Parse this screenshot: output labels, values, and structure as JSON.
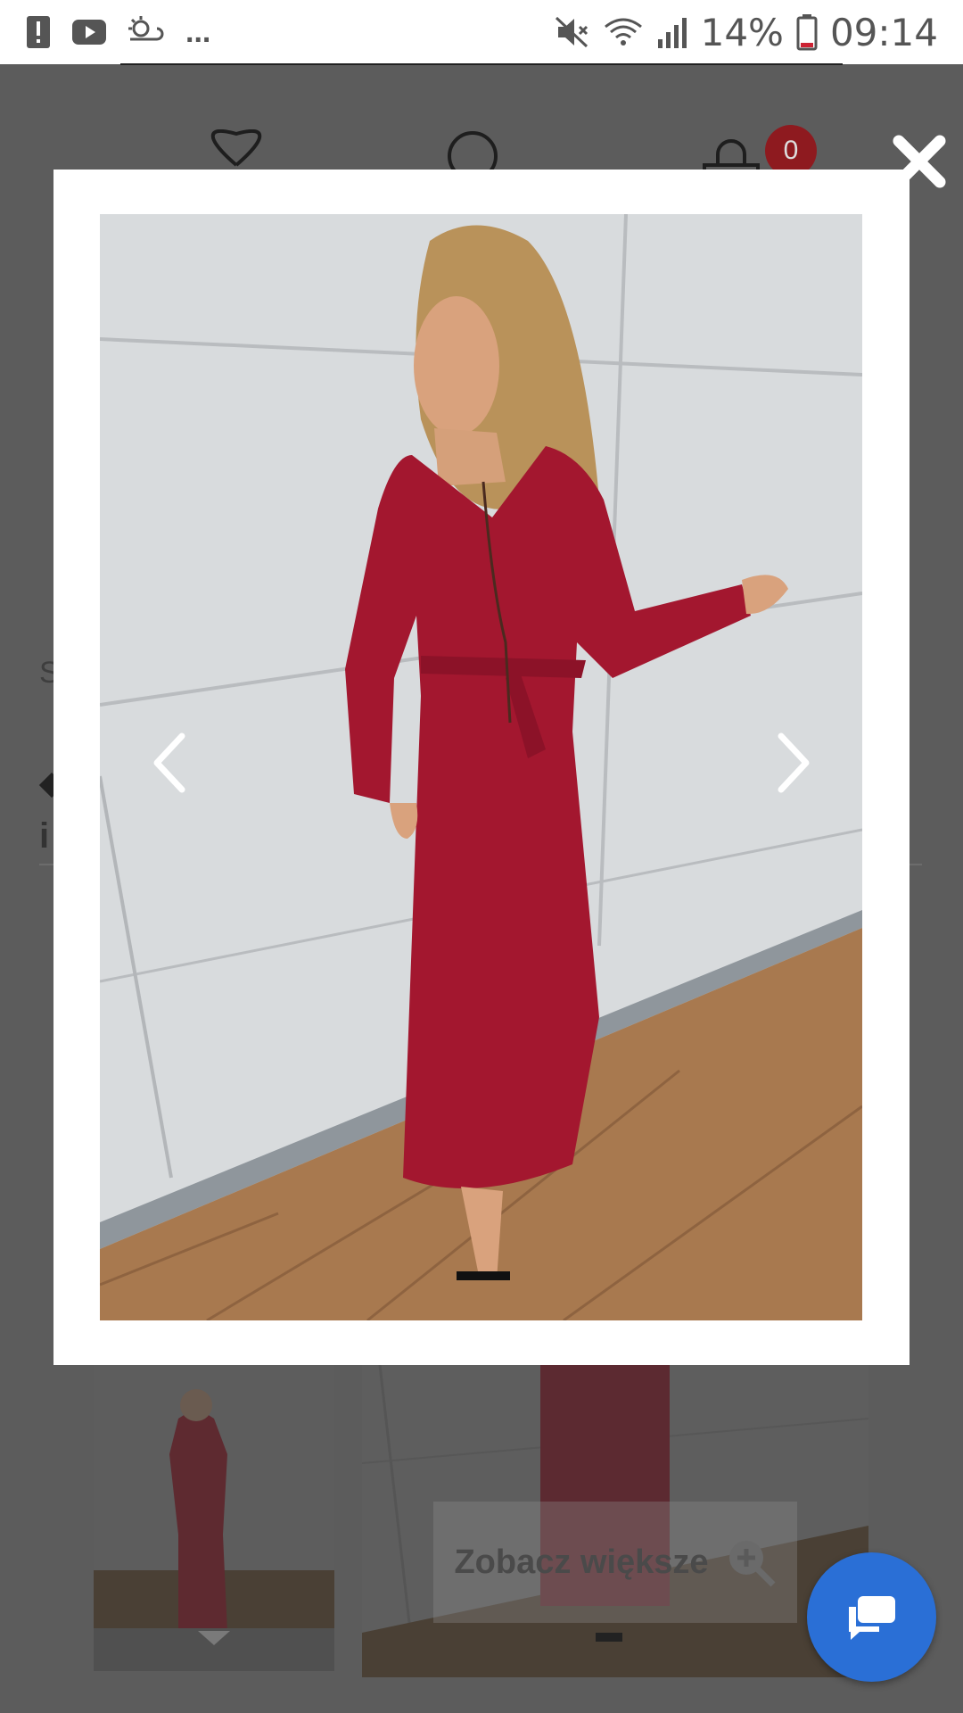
{
  "status_bar": {
    "battery_percent": "14%",
    "time": "09:14",
    "more": "...",
    "icons": [
      "alert-icon",
      "youtube-icon",
      "weather-icon",
      "mute-icon",
      "wifi-icon",
      "signal-icon",
      "battery-icon"
    ]
  },
  "background_page": {
    "cart_count": "0",
    "partial_text_1": "S",
    "partial_text_2": "i",
    "zoom_label": "Zobacz większe",
    "icons": [
      "heart-icon",
      "search-icon",
      "cart-icon",
      "zoom-in-icon",
      "chevron-down-icon"
    ]
  },
  "lightbox": {
    "close_icon": "close-icon",
    "prev_icon": "chevron-left-icon",
    "next_icon": "chevron-right-icon",
    "photo": "woman-in-burgundy-wrap-maxi-dress"
  },
  "chat": {
    "icon": "chat-icon"
  },
  "colors": {
    "overlay": "#5a5a5a",
    "dress": "#a3172f",
    "badge": "#8e1a1f",
    "chat_button": "#2a6fd6"
  }
}
